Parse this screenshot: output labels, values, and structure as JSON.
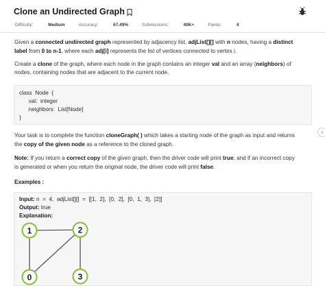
{
  "header": {
    "title": "Clone an Undirected Graph",
    "bookmark_icon": "bookmark-icon",
    "bug_icon": "bug-icon"
  },
  "meta": {
    "difficulty_label": "Difficulty:",
    "difficulty_value": "Medium",
    "accuracy_label": "Accuracy:",
    "accuracy_value": "67.49%",
    "submissions_label": "Submissions:",
    "submissions_value": "40K+",
    "points_label": "Points:",
    "points_value": "4"
  },
  "description": {
    "p1_a": "Given a ",
    "p1_b": "connected undirected graph",
    "p1_c": " represented by adjacency list, ",
    "p1_d": "adjList[][]",
    "p1_e": " with ",
    "p1_f": "n",
    "p1_g": " nodes, having a ",
    "p1_h": "distinct",
    "p1_i": "label",
    "p1_j": " from ",
    "p1_k": "0 to n-1",
    "p1_l": ", where each ",
    "p1_m": "adj[i]",
    "p1_n": " represents the list of vertices connected to vertex i.",
    "p2_a": "Create a ",
    "p2_b": "clone",
    "p2_c": " of the graph, where each node in the graph contains an integer ",
    "p2_d": "val",
    "p2_e": " and an array (",
    "p2_f": "neighbors",
    "p2_g": ") of",
    "p2_h": "nodes, containing nodes that are adjacent to the current node."
  },
  "code": {
    "line1": "class  Node  {",
    "line2": "      val:  integer",
    "line3": "      neighbors:  List[Node]",
    "line4": "}"
  },
  "task": {
    "p3_a": "Your task is to complete the function ",
    "p3_b": "cloneGraph( )",
    "p3_c": " which takes a starting node of the graph as input and returns",
    "p3_d": "the ",
    "p3_e": "copy of the given node",
    "p3_f": " as a reference to the cloned graph.",
    "p4_a": "Note:",
    "p4_b": " If you return a ",
    "p4_c": "correct copy",
    "p4_d": " of the given graph, then the driver code will print ",
    "p4_e": "true",
    "p4_f": "; and if an incorrect copy",
    "p4_g": "is generated or when you return the original node, the driver code will print ",
    "p4_h": "false",
    "p4_i": "."
  },
  "examples": {
    "title": "Examples :",
    "input_label": "Input:",
    "input_value": " n  =  4,  adjList[][]  =  [[1,  2],  [0,  2],  [0,  1,  3],  [2]]",
    "output_label": "Output:",
    "output_value": " true",
    "explanation_label": "Explanation:",
    "nodes": [
      "0",
      "1",
      "2",
      "3"
    ],
    "node_border_color": "#8bc34a"
  },
  "side_toggle": "‹"
}
